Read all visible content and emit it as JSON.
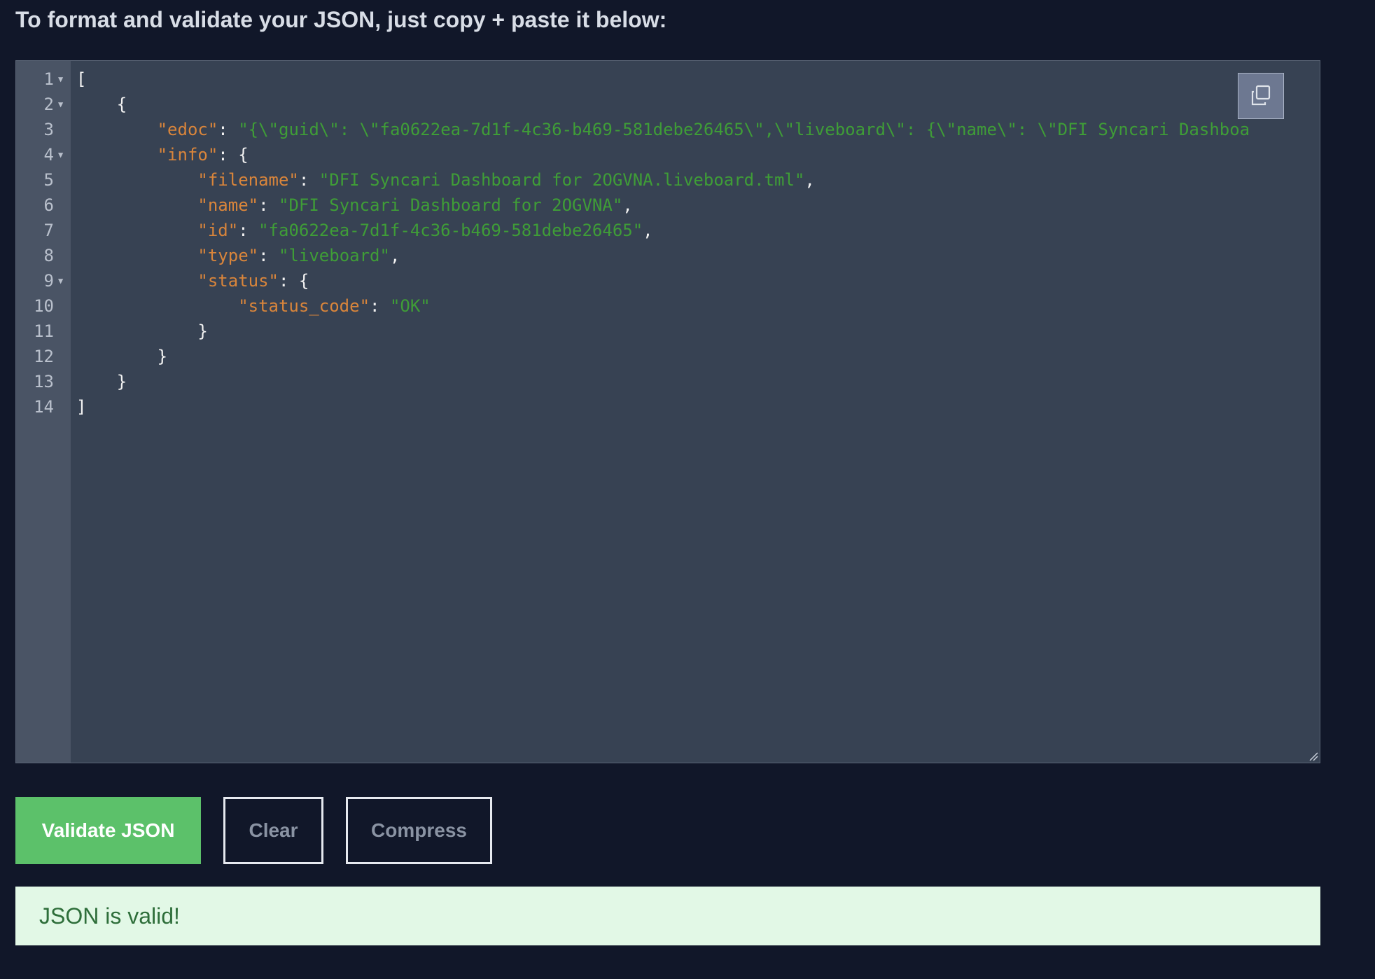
{
  "header": {
    "instruction": "To format and validate your JSON, just copy + paste it below:"
  },
  "editor": {
    "lines": [
      {
        "num": "1",
        "fold": true,
        "tokens": [
          {
            "t": "p",
            "v": "["
          }
        ]
      },
      {
        "num": "2",
        "fold": true,
        "tokens": [
          {
            "t": "p",
            "v": "    {"
          }
        ]
      },
      {
        "num": "3",
        "fold": false,
        "tokens": [
          {
            "t": "p",
            "v": "        "
          },
          {
            "t": "k",
            "v": "\"edoc\""
          },
          {
            "t": "p",
            "v": ": "
          },
          {
            "t": "s",
            "v": "\"{\\\"guid\\\": \\\"fa0622ea-7d1f-4c36-b469-581debe26465\\\",\\\"liveboard\\\": {\\\"name\\\": \\\"DFI Syncari Dashboa"
          }
        ]
      },
      {
        "num": "4",
        "fold": true,
        "tokens": [
          {
            "t": "p",
            "v": "        "
          },
          {
            "t": "k",
            "v": "\"info\""
          },
          {
            "t": "p",
            "v": ": {"
          }
        ]
      },
      {
        "num": "5",
        "fold": false,
        "tokens": [
          {
            "t": "p",
            "v": "            "
          },
          {
            "t": "k",
            "v": "\"filename\""
          },
          {
            "t": "p",
            "v": ": "
          },
          {
            "t": "s",
            "v": "\"DFI Syncari Dashboard for 2OGVNA.liveboard.tml\""
          },
          {
            "t": "p",
            "v": ","
          }
        ]
      },
      {
        "num": "6",
        "fold": false,
        "tokens": [
          {
            "t": "p",
            "v": "            "
          },
          {
            "t": "k",
            "v": "\"name\""
          },
          {
            "t": "p",
            "v": ": "
          },
          {
            "t": "s",
            "v": "\"DFI Syncari Dashboard for 2OGVNA\""
          },
          {
            "t": "p",
            "v": ","
          }
        ]
      },
      {
        "num": "7",
        "fold": false,
        "tokens": [
          {
            "t": "p",
            "v": "            "
          },
          {
            "t": "k",
            "v": "\"id\""
          },
          {
            "t": "p",
            "v": ": "
          },
          {
            "t": "s",
            "v": "\"fa0622ea-7d1f-4c36-b469-581debe26465\""
          },
          {
            "t": "p",
            "v": ","
          }
        ]
      },
      {
        "num": "8",
        "fold": false,
        "tokens": [
          {
            "t": "p",
            "v": "            "
          },
          {
            "t": "k",
            "v": "\"type\""
          },
          {
            "t": "p",
            "v": ": "
          },
          {
            "t": "s",
            "v": "\"liveboard\""
          },
          {
            "t": "p",
            "v": ","
          }
        ]
      },
      {
        "num": "9",
        "fold": true,
        "tokens": [
          {
            "t": "p",
            "v": "            "
          },
          {
            "t": "k",
            "v": "\"status\""
          },
          {
            "t": "p",
            "v": ": {"
          }
        ]
      },
      {
        "num": "10",
        "fold": false,
        "tokens": [
          {
            "t": "p",
            "v": "                "
          },
          {
            "t": "k",
            "v": "\"status_code\""
          },
          {
            "t": "p",
            "v": ": "
          },
          {
            "t": "s",
            "v": "\"OK\""
          }
        ]
      },
      {
        "num": "11",
        "fold": false,
        "tokens": [
          {
            "t": "p",
            "v": "            }"
          }
        ]
      },
      {
        "num": "12",
        "fold": false,
        "tokens": [
          {
            "t": "p",
            "v": "        }"
          }
        ]
      },
      {
        "num": "13",
        "fold": false,
        "tokens": [
          {
            "t": "p",
            "v": "    }"
          }
        ]
      },
      {
        "num": "14",
        "fold": false,
        "tokens": [
          {
            "t": "p",
            "v": "]"
          }
        ]
      }
    ],
    "copy_icon": "copy-icon"
  },
  "actions": {
    "validate_label": "Validate JSON",
    "clear_label": "Clear",
    "compress_label": "Compress"
  },
  "result": {
    "message": "JSON is valid!"
  },
  "colors": {
    "background": "#111729",
    "editor_bg": "#374253",
    "key": "#d9853b",
    "string": "#3f9d37",
    "validate_button": "#5cc16a",
    "success_bg": "#e2f8e6",
    "success_text": "#2e6e3a"
  }
}
